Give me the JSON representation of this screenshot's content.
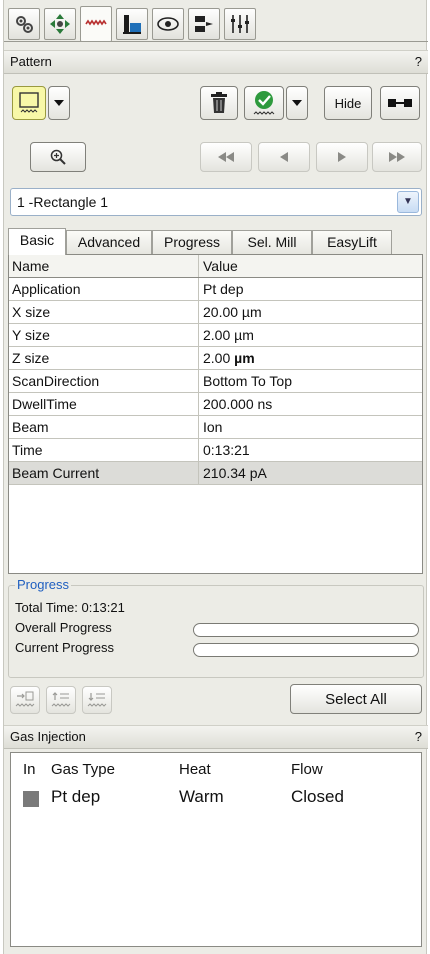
{
  "toolbar": {
    "icons": [
      "settings-icon",
      "move-icon",
      "pattern-icon",
      "alignment-icon",
      "view-icon",
      "navigation-icon",
      "detectors-icon"
    ]
  },
  "pattern": {
    "header": "Pattern",
    "help": "?",
    "hide_label": "Hide",
    "selected": "1 -Rectangle 1",
    "tabs": [
      "Basic",
      "Advanced",
      "Progress",
      "Sel. Mill",
      "EasyLift"
    ],
    "columns": [
      "Name",
      "Value"
    ],
    "rows": [
      {
        "name": "Application",
        "value": "Pt dep"
      },
      {
        "name": "X size",
        "value": "20.00 µm"
      },
      {
        "name": "Y size",
        "value": "2.00 µm"
      },
      {
        "name": "Z size",
        "value_num": "2.00",
        "value_unit": "µm"
      },
      {
        "name": "ScanDirection",
        "value": "Bottom To Top"
      },
      {
        "name": "DwellTime",
        "value": "200.000 ns"
      },
      {
        "name": "Beam",
        "value": "Ion"
      },
      {
        "name": "Time",
        "value": "0:13:21"
      },
      {
        "name": "Beam Current",
        "value": "210.34 pA"
      }
    ]
  },
  "progress": {
    "title": "Progress",
    "total_label": "Total Time:",
    "total_value": "0:13:21",
    "overall_label": "Overall Progress",
    "overall_value": 0,
    "current_label": "Current Progress",
    "current_value": 0
  },
  "select_all_label": "Select All",
  "gas": {
    "header": "Gas Injection",
    "help": "?",
    "columns": [
      "In",
      "Gas Type",
      "Heat",
      "Flow"
    ],
    "rows": [
      {
        "type": "Pt dep",
        "heat": "Warm",
        "flow": "Closed",
        "color": "#7a7a7a"
      }
    ]
  }
}
